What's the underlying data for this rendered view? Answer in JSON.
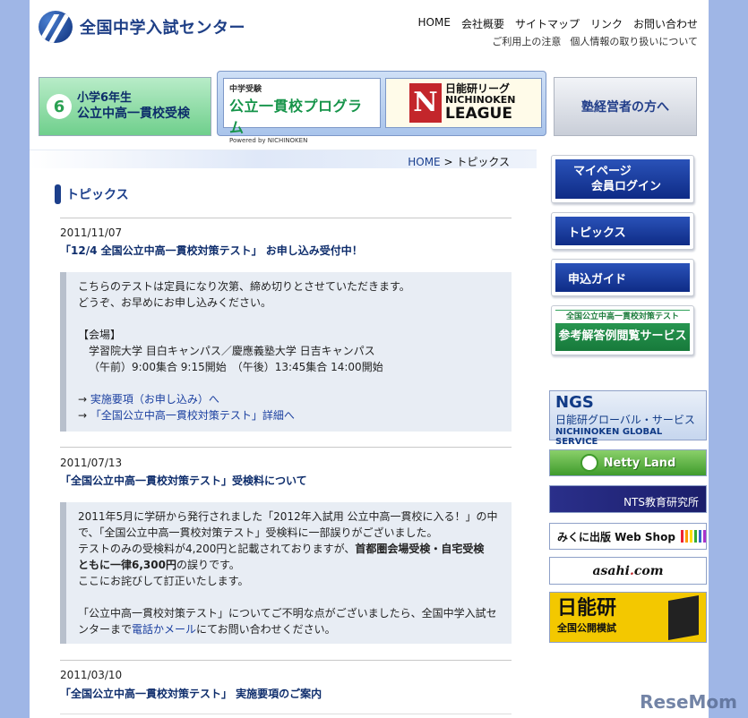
{
  "header": {
    "logo_text": "全国中学入試センター",
    "nav": [
      "HOME",
      "会社概要",
      "サイトマップ",
      "リンク",
      "お問い合わせ"
    ],
    "subnav": [
      "ご利用上の注意",
      "個人情報の取り扱いについて"
    ]
  },
  "banners": {
    "grade6": {
      "number": "6",
      "line1": "小学6年生",
      "line2": "公立中高一貫校受検"
    },
    "koritsu": {
      "sub": "中学受験",
      "main": "公立一貫校プログラム",
      "powered": "Powered by NICHINOKEN"
    },
    "league": {
      "mark": "N",
      "line1": "日能研リーグ",
      "line2": "NICHINOKEN",
      "line3": "LEAGUE"
    },
    "juku": "塾経営者の方へ"
  },
  "breadcrumb": {
    "home": "HOME",
    "separator": ">",
    "current": "トピックス"
  },
  "topics_heading": "トピックス",
  "posts": [
    {
      "date": "2011/11/07",
      "title": "「12/4 全国公立中高一貫校対策テスト」 お申し込み受付中！",
      "lines": [
        "こちらのテストは定員になり次第、締め切りとさせていただきます。",
        "どうぞ、お早めにお申し込みください。",
        "【会場】",
        "学習院大学 目白キャンパス／慶應義塾大学 日吉キャンパス",
        "（午前）9:00集合 9:15開始　（午後）13:45集合 14:00開始"
      ],
      "links": [
        {
          "arrow": "→",
          "text": "実施要項（お申し込み）へ"
        },
        {
          "arrow": "→",
          "text": "「全国公立中高一貫校対策テスト」詳細へ"
        }
      ]
    },
    {
      "date": "2011/07/13",
      "title": "「全国公立中高一貫校対策テスト」受検料について",
      "lines": [
        "2011年5月に学研から発行されました「2012年入試用 公立中高一貫校に入る！」の中",
        "で、「全国公立中高一貫校対策テスト」受検料に一部誤りがございました。",
        "テストのみの受検料が4,200円と記載されておりますが、",
        "首都圏会場受検・自宅受検",
        "ともに一律6,300円",
        "の誤りです。",
        "ここにお詫びして訂正いたします。",
        "「公立中高一貫校対策テスト」についてご不明な点がございましたら、全国中学入試セ",
        "ンターまで",
        "電話かメール",
        "にてお問い合わせください。"
      ]
    },
    {
      "date": "2011/03/10",
      "title": "「全国公立中高一貫校対策テスト」 実施要項のご案内"
    }
  ],
  "sidenav": {
    "mypage_l1": "マイページ",
    "mypage_l2": "会員ログイン",
    "topics": "トピックス",
    "guide": "申込ガイド",
    "answer_l1": "全国公立中高一貫校対策テスト",
    "answer_l2": "参考解答例閲覧サービス"
  },
  "right_banners": {
    "ngs_title": "NGS",
    "ngs_l2": "日能研グローバル・サービス",
    "ngs_l3": "NICHINOKEN GLOBAL SERVICE",
    "netty": "Netty Land",
    "nts": "NTS教育研究所",
    "mikuni": "みくに出版 Web Shop",
    "asahi_a": "asahi",
    "asahi_dot": ".",
    "asahi_b": "com",
    "zenkoku_l1": "日能研",
    "zenkoku_l2": "全国公開模試"
  },
  "watermark": "ReseMom",
  "colors": {
    "page_bg": "#9fb6e6",
    "navy": "#0e2d6c",
    "button_blue": "#0e2b86",
    "box_bg": "#e8edf4",
    "green": "#2fa25a"
  }
}
